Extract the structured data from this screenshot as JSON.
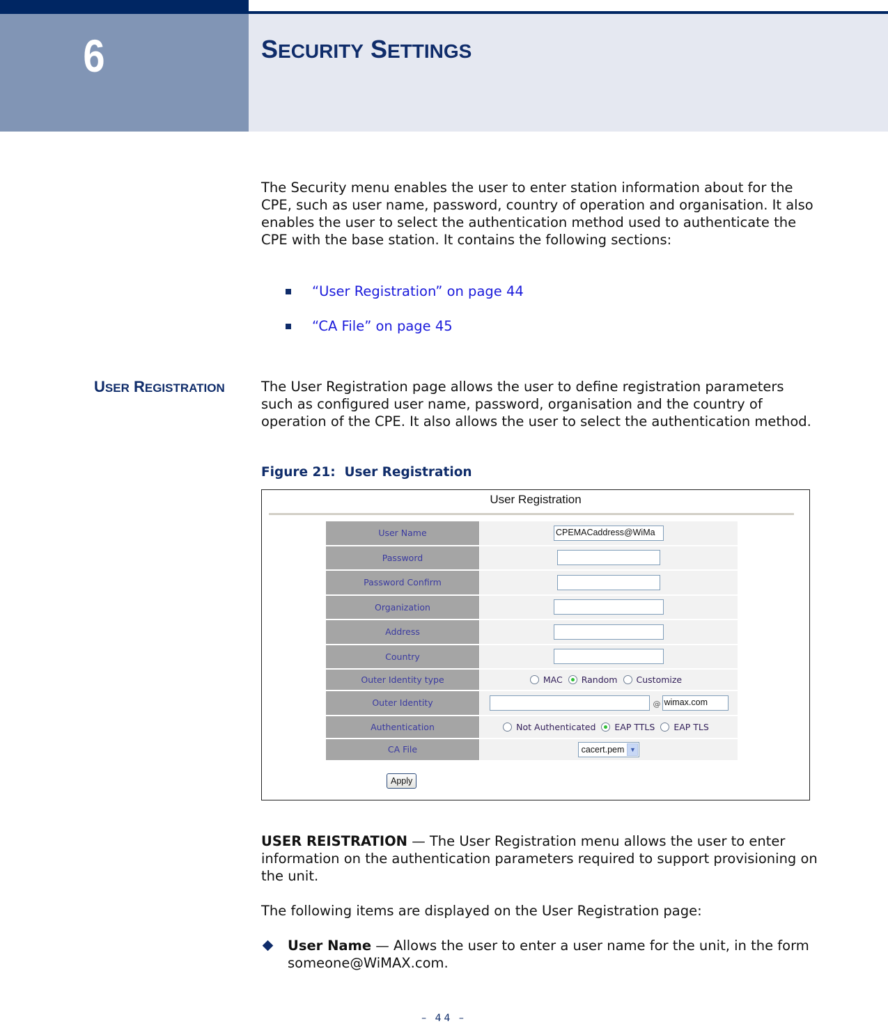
{
  "chapter": {
    "number": "6",
    "title_first_cap": "S",
    "title_first_rest": "ECURITY",
    "title_second_cap": "S",
    "title_second_rest": "ETTINGS"
  },
  "intro": {
    "paragraph": "The Security menu enables the user to enter station information about for the CPE, such as user name, password, country of operation and organisation. It also enables the user to select the authentication method used to authenticate the CPE with the base station. It contains the following sections:",
    "links": [
      {
        "label": "“User Registration” on page 44"
      },
      {
        "label": "“CA File” on page 45"
      }
    ]
  },
  "section": {
    "heading_first_cap": "U",
    "heading_first_rest": "SER",
    "heading_second_cap": "R",
    "heading_second_rest": "EGISTRATION",
    "paragraph": "The User Registration page allows the user to define registration parameters such as configured user name, password, organisation and the country of operation of the CPE. It also allows the user to select the authentication method."
  },
  "figure": {
    "caption": "Figure 21:  User Registration",
    "title": "User Registration",
    "rows": [
      {
        "label": "User Name",
        "value": "CPEMACaddress@WiMa"
      },
      {
        "label": "Password",
        "value": ""
      },
      {
        "label": "Password Confirm",
        "value": ""
      },
      {
        "label": "Organization",
        "value": ""
      },
      {
        "label": "Address",
        "value": ""
      },
      {
        "label": "Country",
        "value": ""
      },
      {
        "label": "Outer Identity type",
        "options": [
          "MAC",
          "Random",
          "Customize"
        ],
        "selected": "Random"
      },
      {
        "label": "Outer Identity",
        "value": "",
        "at": "@",
        "domain": "wimax.com"
      },
      {
        "label": "Authentication",
        "options": [
          "Not Authenticated",
          "EAP TTLS",
          "EAP TLS"
        ],
        "selected": "EAP TTLS"
      },
      {
        "label": "CA File",
        "selected": "cacert.pem"
      }
    ],
    "apply_label": "Apply"
  },
  "description": {
    "lead_bold": "USER REISTRATION",
    "lead_rest": " — The User Registration menu allows the user to enter information on the authentication parameters required to support provisioning on the unit.",
    "items_intro": "The following items are displayed on the User Registration page:",
    "items": [
      {
        "term": "User Name",
        "text": " — Allows the user to enter a user name for the unit, in the form someone@WiMAX.com."
      }
    ]
  },
  "footer": {
    "page_number": "–  44  –"
  }
}
